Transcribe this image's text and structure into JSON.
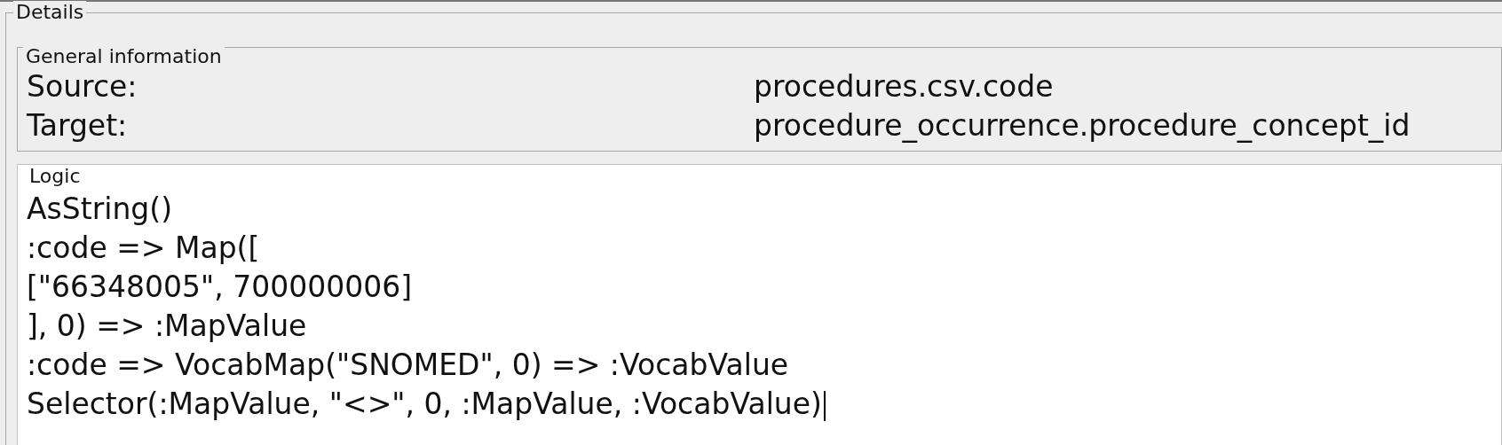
{
  "details": {
    "title": "Details",
    "general_information": {
      "title": "General information",
      "rows": [
        {
          "label": "Source:",
          "value": "procedures.csv.code"
        },
        {
          "label": "Target:",
          "value": "procedure_occurrence.procedure_concept_id"
        }
      ]
    },
    "logic": {
      "title": "Logic",
      "lines": [
        "AsString()",
        ":code => Map([",
        "[\"66348005\", 700000006]",
        "], 0) => :MapValue",
        ":code => VocabMap(\"SNOMED\", 0) => :VocabValue",
        "Selector(:MapValue, \"<>\", 0, :MapValue, :VocabValue)"
      ]
    }
  }
}
